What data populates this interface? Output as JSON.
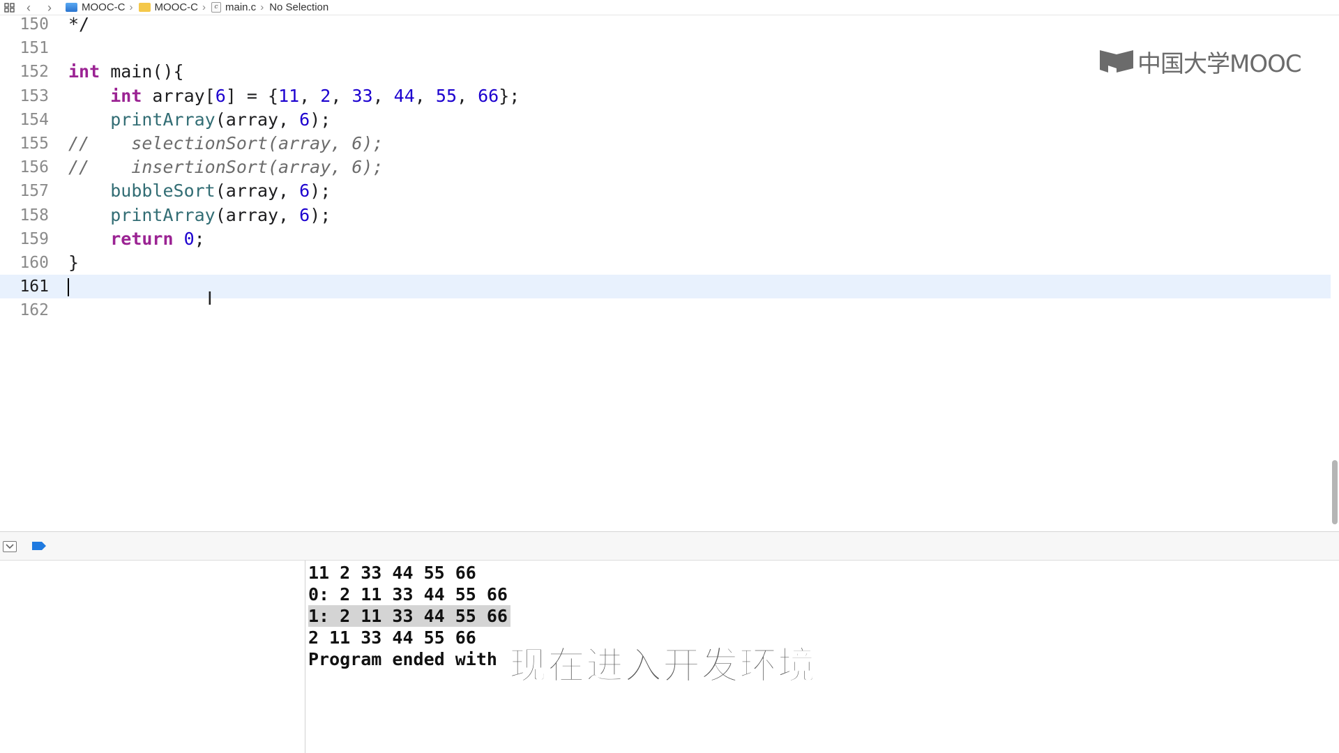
{
  "jumpbar": {
    "crumbs": [
      {
        "label": "MOOC-C",
        "icon": "project-icon"
      },
      {
        "label": "MOOC-C",
        "icon": "folder-icon"
      },
      {
        "label": "main.c",
        "icon": "c-file-icon"
      },
      {
        "label": "No Selection",
        "icon": ""
      }
    ],
    "file_icon_glyph": "c"
  },
  "editor": {
    "lines": [
      {
        "num": "150",
        "text": "*/"
      },
      {
        "num": "151",
        "text": ""
      },
      {
        "num": "152",
        "text": "int main(){"
      },
      {
        "num": "153",
        "text": "    int array[6] = {11, 2, 33, 44, 55, 66};"
      },
      {
        "num": "154",
        "text": "    printArray(array, 6);"
      },
      {
        "num": "155",
        "text": "//    selectionSort(array, 6);"
      },
      {
        "num": "156",
        "text": "//    insertionSort(array, 6);"
      },
      {
        "num": "157",
        "text": "    bubbleSort(array, 6);"
      },
      {
        "num": "158",
        "text": "    printArray(array, 6);"
      },
      {
        "num": "159",
        "text": "    return 0;"
      },
      {
        "num": "160",
        "text": "}"
      },
      {
        "num": "161",
        "text": ""
      },
      {
        "num": "162",
        "text": ""
      }
    ],
    "current_line": "161"
  },
  "watermark": {
    "text": "中国大学MOOC"
  },
  "console": {
    "lines": [
      "11 2 33 44 55 66",
      "0: 2 11 33 44 55 66",
      "1: 2 11 33 44 55 66",
      "2 11 33 44 55 66",
      "Program ended with"
    ],
    "selected_line_index": 2
  },
  "subtitle": {
    "text": "现在进入开发环境"
  },
  "colors": {
    "keyword": "#9b2393",
    "number": "#1c00cf",
    "function": "#326d74",
    "comment": "#6c6c6c",
    "current_line_bg": "#e8f1fd",
    "breakpoint_blue": "#1f7ae0"
  }
}
